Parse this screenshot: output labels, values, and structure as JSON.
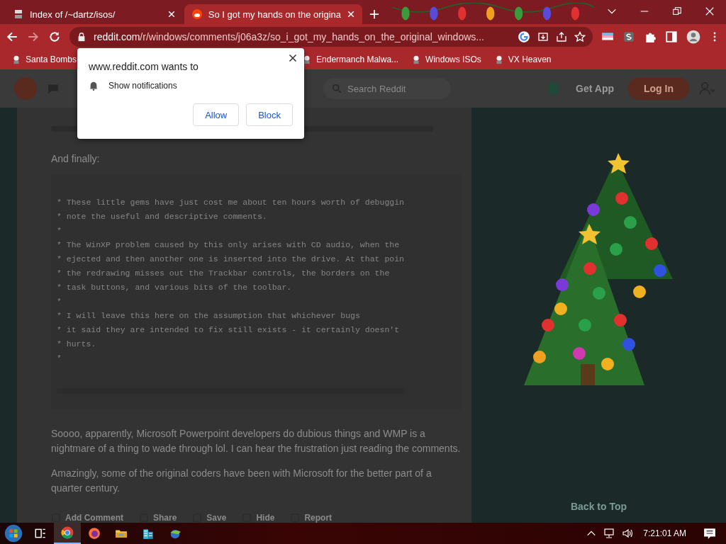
{
  "tabs": [
    {
      "title": "Index of /~dartz/isos/",
      "selected": false
    },
    {
      "title": "So I got my hands on the origina",
      "selected": true
    }
  ],
  "address_bar": {
    "host": "reddit.com",
    "path": "/r/windows/comments/j06a3z/so_i_got_my_hands_on_the_original_windows..."
  },
  "bookmarks": [
    "Santa Bombs",
    "Endermanch Malwa...",
    "Windows ISOs",
    "VX Heaven"
  ],
  "permission_prompt": {
    "title": "www.reddit.com wants to",
    "permission": "Show notifications",
    "buttons": [
      "Allow",
      "Block"
    ]
  },
  "reddit_header": {
    "search_placeholder": "Search Reddit",
    "get_app": "Get App",
    "login": "Log In"
  },
  "post": {
    "intro": "And finally:",
    "code_lines": [
      "* These little gems have just cost me about ten hours worth of debuggin",
      "* note the useful and descriptive comments.",
      "*",
      "* The WinXP problem caused by this only arises with CD audio, when the",
      "* ejected and then another one is inserted into the drive. At that poin",
      "* the redrawing misses out the Trackbar controls, the borders on the",
      "* task buttons, and various bits of the toolbar.",
      "*",
      "* I will leave this here on the assumption that whichever bugs",
      "* it said they are intended to fix still exists - it certainly doesn't",
      "* hurts.",
      "*"
    ],
    "paragraphs": [
      "Soooo, apparently, Microsoft Powerpoint developers do dubious things and WMP is a nightmare of a thing to wade through lol. I can hear the frustration just reading the comments.",
      "Amazingly, some of the original coders have been with Microsoft for the better part of a quarter century."
    ],
    "actions": [
      "Add Comment",
      "Share",
      "Save",
      "Hide",
      "Report"
    ]
  },
  "sidebar": {
    "back_to_top": "Back to Top"
  },
  "taskbar": {
    "apps": [
      {
        "kind": "taskview",
        "selected": false
      },
      {
        "kind": "chrome",
        "selected": true
      },
      {
        "kind": "firefox",
        "selected": false
      },
      {
        "kind": "explorer",
        "selected": false
      },
      {
        "kind": "building",
        "selected": false
      },
      {
        "kind": "globe",
        "selected": false
      }
    ],
    "time": "7:21:01 AM"
  }
}
